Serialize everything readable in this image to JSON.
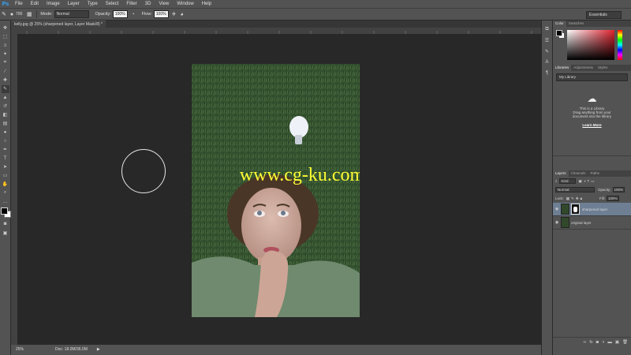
{
  "app": {
    "logo": "Ps"
  },
  "menu": [
    "File",
    "Edit",
    "Image",
    "Layer",
    "Type",
    "Select",
    "Filter",
    "3D",
    "View",
    "Window",
    "Help"
  ],
  "options": {
    "brush_size": "700",
    "mode_label": "Mode:",
    "mode_value": "Normal",
    "opacity_label": "Opacity:",
    "opacity_value": "100%",
    "flow_label": "Flow:",
    "flow_value": "100%",
    "workspace": "Essentials"
  },
  "document": {
    "tab_title": "kelly.jpg @ 25% (sharpened layer, Layer Mask/8) *",
    "watermark": "www.cg-ku.com"
  },
  "status": {
    "zoom": "25%",
    "doc_size": "Doc: 18.0M/36.0M"
  },
  "panels": {
    "color_tabs": [
      "Color",
      "Swatches"
    ],
    "library_tabs": [
      "Libraries",
      "Adjustments",
      "Styles"
    ],
    "library_name": "My Library",
    "library_empty_line1": "This is a Library",
    "library_empty_line2": "Drag anything from your",
    "library_empty_line3": "document into the library",
    "learn_more": "Learn More",
    "layers_tabs": [
      "Layers",
      "Channels",
      "Paths"
    ],
    "kind_label": "Kind",
    "blend_mode": "Normal",
    "opacity_label": "Opacity:",
    "opacity_value": "100%",
    "lock_label": "Lock:",
    "fill_label": "Fill:",
    "fill_value": "100%",
    "layers": [
      {
        "name": "sharpened layer",
        "selected": true
      },
      {
        "name": "original layer",
        "selected": false
      }
    ]
  },
  "colors": {
    "accent": "#31a8ff",
    "selection": "#6e7f94",
    "panel": "#535353",
    "canvas": "#282828",
    "watermark": "#ffff33"
  }
}
